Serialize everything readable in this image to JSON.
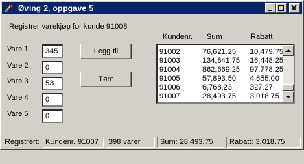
{
  "window": {
    "title": "Øving 2, oppgave 5",
    "controls": {
      "minimize": "minimize",
      "maximize": "maximize",
      "close": "close"
    }
  },
  "form": {
    "heading": "Registrer varekjøp for kunde 91008",
    "fields": [
      {
        "label": "Vare 1",
        "value": "345"
      },
      {
        "label": "Vare 2",
        "value": "0"
      },
      {
        "label": "Vare 3",
        "value": "53"
      },
      {
        "label": "Vare 4",
        "value": "0"
      },
      {
        "label": "Vare 5",
        "value": "0"
      }
    ],
    "buttons": {
      "add": "Legg til",
      "clear": "Tøm"
    }
  },
  "list": {
    "headers": {
      "customer": "Kundenr.",
      "sum": "Sum",
      "discount": "Rabatt"
    },
    "rows": [
      {
        "customer": "91002",
        "sum": "76,621.25",
        "discount": "10,479.75"
      },
      {
        "customer": "91003",
        "sum": "134,841.75",
        "discount": "16,448.25"
      },
      {
        "customer": "91004",
        "sum": "862,669.25",
        "discount": "97,778.25"
      },
      {
        "customer": "91005",
        "sum": "57,893.50",
        "discount": "4,655.00"
      },
      {
        "customer": "91006",
        "sum": "6,768.23",
        "discount": "327.27"
      },
      {
        "customer": "91007",
        "sum": "28,493.75",
        "discount": "3,018.75"
      }
    ]
  },
  "status": {
    "label": "Registrert:",
    "customer": "Kundenr. 91007",
    "items": "398 varer",
    "sum": "Sum: 28,493.75",
    "discount": "Rabatt: 3,018.75"
  }
}
